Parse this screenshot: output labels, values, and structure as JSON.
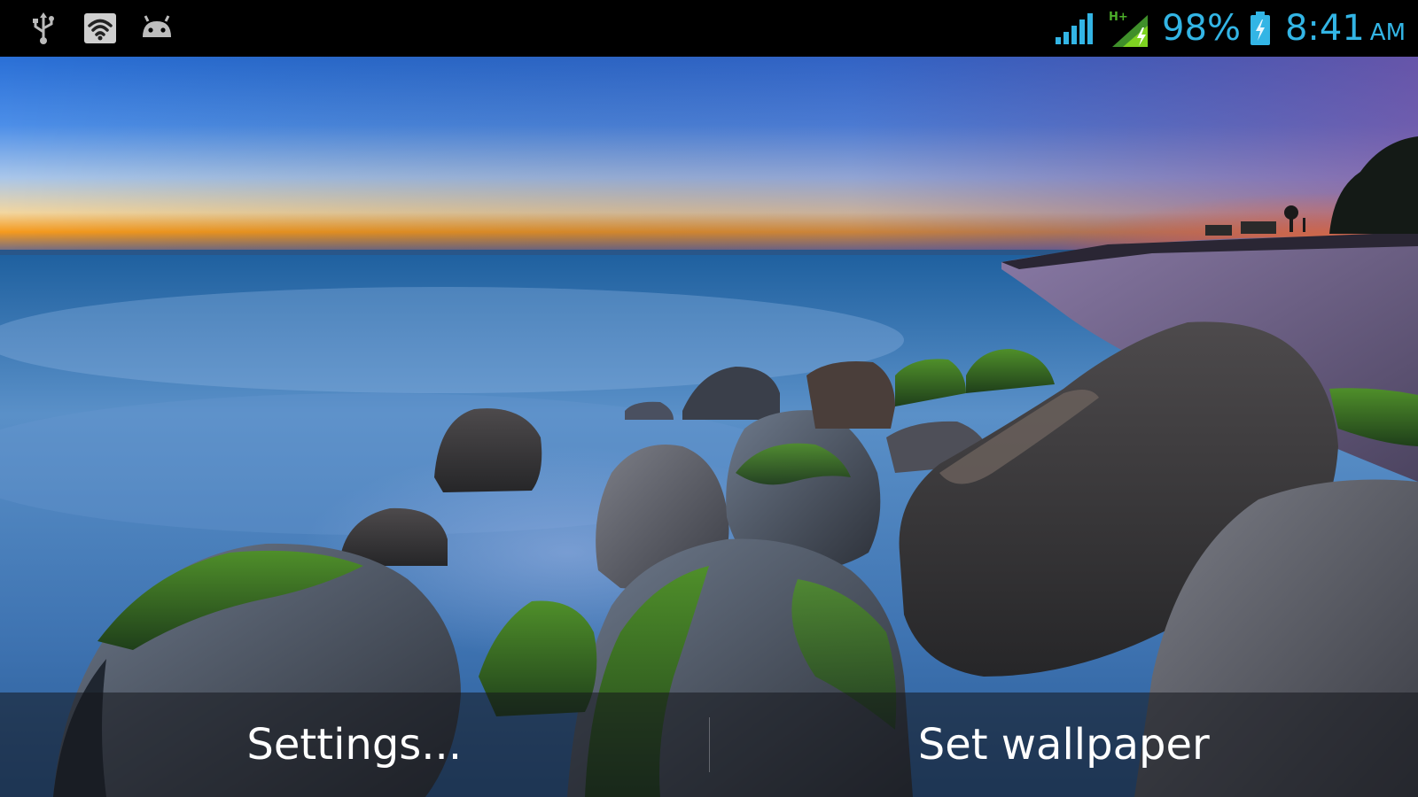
{
  "status_bar": {
    "left_icons": [
      "usb-icon",
      "wifi-hotspot-icon",
      "android-icon"
    ],
    "network_type": "H+",
    "battery_percent": "98%",
    "battery_level": 0.98,
    "time": "8:41",
    "am_pm": "AM",
    "accent_color": "#33b5e5"
  },
  "wallpaper": {
    "description_icon": "sunset-beach-rocks-image"
  },
  "action_bar": {
    "settings_label": "Settings...",
    "set_wallpaper_label": "Set wallpaper"
  }
}
